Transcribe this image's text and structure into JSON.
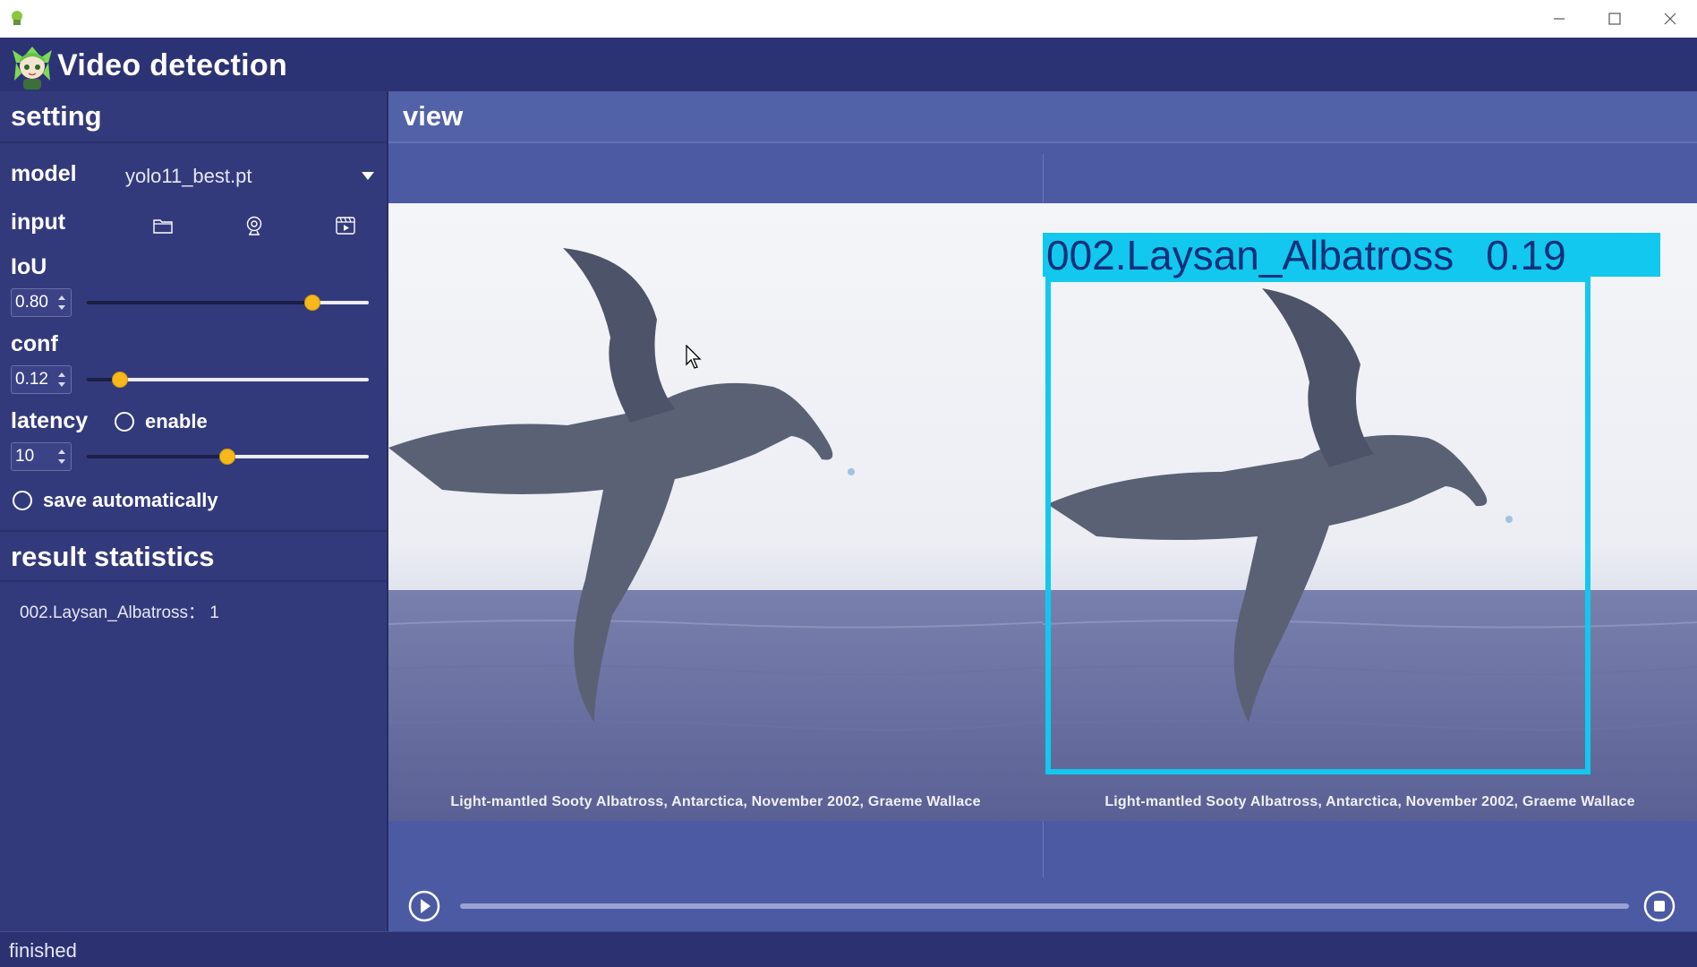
{
  "app": {
    "title": "Video detection"
  },
  "settings": {
    "section_title": "setting",
    "model": {
      "label": "model",
      "value": "yolo11_best.pt"
    },
    "input": {
      "label": "input",
      "buttons": [
        {
          "icon": "folder-icon"
        },
        {
          "icon": "webcam-icon"
        },
        {
          "icon": "video-file-icon"
        }
      ]
    },
    "iou": {
      "label": "IoU",
      "value": "0.80",
      "level": 0.8
    },
    "conf": {
      "label": "conf",
      "value": "0.12",
      "level": 0.12
    },
    "latency": {
      "label": "latency",
      "enable_label": "enable",
      "enabled": false,
      "value": "10",
      "level": 0.5
    },
    "save_auto": {
      "label": "save automatically",
      "checked": false
    }
  },
  "stats": {
    "section_title": "result statistics",
    "items": [
      "002.Laysan_Albatross： 1"
    ]
  },
  "view": {
    "title": "view",
    "caption": "Light-mantled Sooty Albatross, Antarctica, November 2002, Graeme Wallace",
    "detection": {
      "class_name": "002.Laysan_Albatross",
      "score": "0.19"
    },
    "box_color": "#12c8ee",
    "play_progress": 0.0
  },
  "status": {
    "text": "finished"
  },
  "colors": {
    "accent": "#f6b81b",
    "header": "#2c3374",
    "sidebar": "#333a7c",
    "view": "#4c5aa3"
  }
}
